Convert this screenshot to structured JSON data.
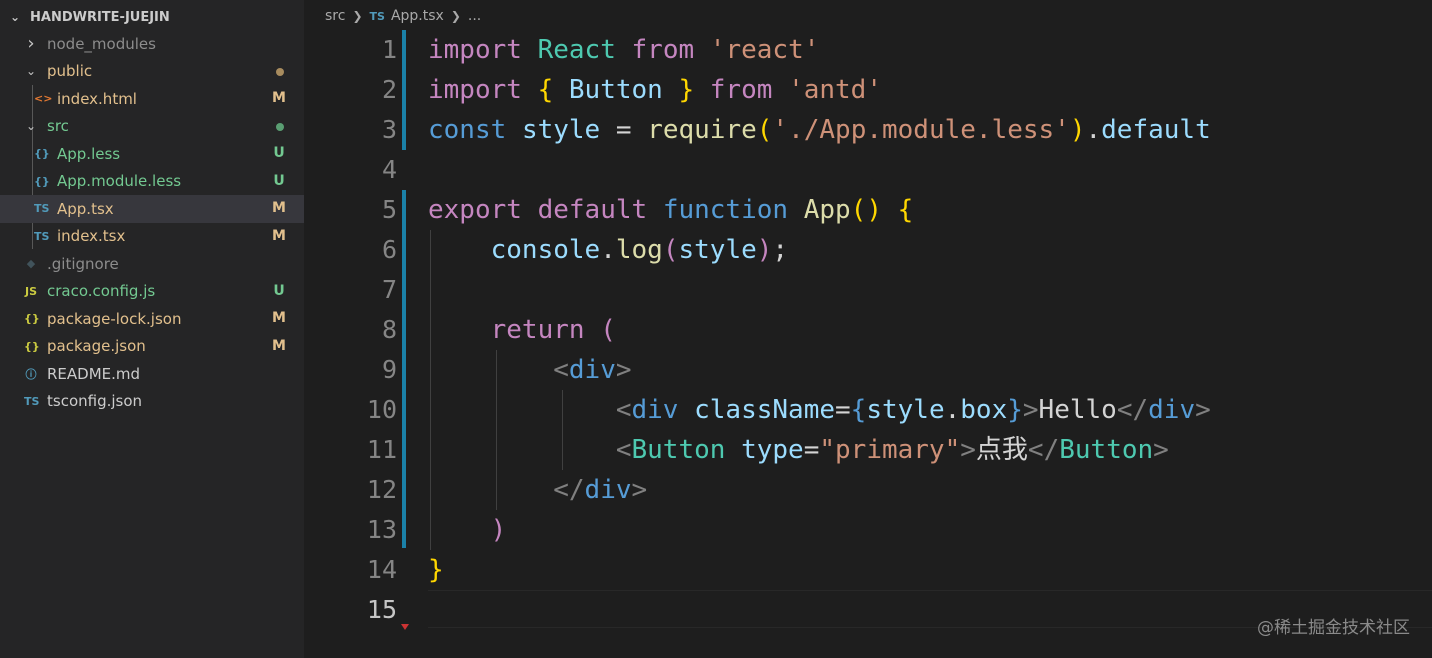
{
  "explorer": {
    "title": "HANDWRITE-JUEJIN",
    "items": [
      {
        "label": "node_modules",
        "kind": "folder",
        "state": "collapsed",
        "depth": 1,
        "color": "#8c8c8c",
        "status": "",
        "status_color": ""
      },
      {
        "label": "public",
        "kind": "folder",
        "state": "expanded",
        "depth": 1,
        "color": "#e2c08d",
        "status": "dot",
        "status_color": "#a88c5e"
      },
      {
        "label": "index.html",
        "kind": "file",
        "icon": "html-icon",
        "glyph": "<>",
        "icon_color": "#e37933",
        "depth": 2,
        "color": "#e2c08d",
        "status": "M",
        "status_color": "#e2c08d"
      },
      {
        "label": "src",
        "kind": "folder",
        "state": "expanded",
        "depth": 1,
        "color": "#73c991",
        "status": "dot",
        "status_color": "#5a9e72"
      },
      {
        "label": "App.less",
        "kind": "file",
        "icon": "less-icon",
        "glyph": "{}",
        "icon_color": "#519aba",
        "depth": 2,
        "color": "#73c991",
        "status": "U",
        "status_color": "#73c991"
      },
      {
        "label": "App.module.less",
        "kind": "file",
        "icon": "less-icon",
        "glyph": "{}",
        "icon_color": "#519aba",
        "depth": 2,
        "color": "#73c991",
        "status": "U",
        "status_color": "#73c991"
      },
      {
        "label": "App.tsx",
        "kind": "file",
        "icon": "typescript-icon",
        "glyph": "TS",
        "icon_color": "#519aba",
        "depth": 2,
        "color": "#e2c08d",
        "status": "M",
        "status_color": "#e2c08d",
        "selected": true
      },
      {
        "label": "index.tsx",
        "kind": "file",
        "icon": "typescript-icon",
        "glyph": "TS",
        "icon_color": "#519aba",
        "depth": 2,
        "color": "#e2c08d",
        "status": "M",
        "status_color": "#e2c08d"
      },
      {
        "label": ".gitignore",
        "kind": "file",
        "icon": "git-icon",
        "glyph": "◆",
        "icon_color": "#41535b",
        "depth": 1,
        "color": "#8c8c8c",
        "status": "",
        "status_color": ""
      },
      {
        "label": "craco.config.js",
        "kind": "file",
        "icon": "javascript-icon",
        "glyph": "JS",
        "icon_color": "#cbcb41",
        "depth": 1,
        "color": "#73c991",
        "status": "U",
        "status_color": "#73c991"
      },
      {
        "label": "package-lock.json",
        "kind": "file",
        "icon": "json-icon",
        "glyph": "{}",
        "icon_color": "#cbcb41",
        "depth": 1,
        "color": "#e2c08d",
        "status": "M",
        "status_color": "#e2c08d"
      },
      {
        "label": "package.json",
        "kind": "file",
        "icon": "json-icon",
        "glyph": "{}",
        "icon_color": "#cbcb41",
        "depth": 1,
        "color": "#e2c08d",
        "status": "M",
        "status_color": "#e2c08d"
      },
      {
        "label": "README.md",
        "kind": "file",
        "icon": "info-icon",
        "glyph": "ⓘ",
        "icon_color": "#519aba",
        "depth": 1,
        "color": "#cccccc",
        "status": "",
        "status_color": ""
      },
      {
        "label": "tsconfig.json",
        "kind": "file",
        "icon": "tsconfig-icon",
        "glyph": "TS",
        "icon_color": "#519aba",
        "depth": 1,
        "color": "#cccccc",
        "status": "",
        "status_color": ""
      }
    ]
  },
  "breadcrumb": {
    "folder": "src",
    "file_icon": "TS",
    "file": "App.tsx",
    "more": "..."
  },
  "editor": {
    "active_line": 15,
    "lines": [
      {
        "n": "1",
        "tokens": [
          [
            "kw",
            "import"
          ],
          [
            "def",
            " "
          ],
          [
            "tagc",
            "React"
          ],
          [
            "def",
            " "
          ],
          [
            "kw",
            "from"
          ],
          [
            "def",
            " "
          ],
          [
            "str",
            "'react'"
          ]
        ]
      },
      {
        "n": "2",
        "tokens": [
          [
            "kw",
            "import"
          ],
          [
            "def",
            " "
          ],
          [
            "gold",
            "{"
          ],
          [
            "def",
            " "
          ],
          [
            "var",
            "Button"
          ],
          [
            "def",
            " "
          ],
          [
            "gold",
            "}"
          ],
          [
            "def",
            " "
          ],
          [
            "kw",
            "from"
          ],
          [
            "def",
            " "
          ],
          [
            "str",
            "'antd'"
          ]
        ]
      },
      {
        "n": "3",
        "tokens": [
          [
            "st",
            "const"
          ],
          [
            "def",
            " "
          ],
          [
            "var",
            "style"
          ],
          [
            "def",
            " = "
          ],
          [
            "fn",
            "require"
          ],
          [
            "gold",
            "("
          ],
          [
            "str",
            "'./App.module.less'"
          ],
          [
            "gold",
            ")"
          ],
          [
            "def",
            "."
          ],
          [
            "var",
            "default"
          ]
        ]
      },
      {
        "n": "4",
        "tokens": []
      },
      {
        "n": "5",
        "tokens": [
          [
            "kw",
            "export"
          ],
          [
            "def",
            " "
          ],
          [
            "kw",
            "default"
          ],
          [
            "def",
            " "
          ],
          [
            "st",
            "function"
          ],
          [
            "def",
            " "
          ],
          [
            "fn",
            "App"
          ],
          [
            "gold",
            "()"
          ],
          [
            "def",
            " "
          ],
          [
            "gold",
            "{"
          ]
        ]
      },
      {
        "n": "6",
        "tokens": [
          [
            "def",
            "    "
          ],
          [
            "var",
            "console"
          ],
          [
            "def",
            "."
          ],
          [
            "fn",
            "log"
          ],
          [
            "kw",
            "("
          ],
          [
            "var",
            "style"
          ],
          [
            "kw",
            ")"
          ],
          [
            "def",
            ";"
          ]
        ]
      },
      {
        "n": "7",
        "tokens": []
      },
      {
        "n": "8",
        "tokens": [
          [
            "def",
            "    "
          ],
          [
            "kw",
            "return"
          ],
          [
            "def",
            " "
          ],
          [
            "kw",
            "("
          ]
        ]
      },
      {
        "n": "9",
        "tokens": [
          [
            "def",
            "        "
          ],
          [
            "br",
            "<"
          ],
          [
            "tag",
            "div"
          ],
          [
            "br",
            ">"
          ]
        ]
      },
      {
        "n": "10",
        "tokens": [
          [
            "def",
            "            "
          ],
          [
            "br",
            "<"
          ],
          [
            "tag",
            "div"
          ],
          [
            "def",
            " "
          ],
          [
            "var",
            "className"
          ],
          [
            "def",
            "="
          ],
          [
            "bk",
            "{"
          ],
          [
            "var",
            "style"
          ],
          [
            "def",
            "."
          ],
          [
            "var",
            "box"
          ],
          [
            "bk",
            "}"
          ],
          [
            "br",
            ">"
          ],
          [
            "def",
            "Hello"
          ],
          [
            "br",
            "</"
          ],
          [
            "tag",
            "div"
          ],
          [
            "br",
            ">"
          ]
        ]
      },
      {
        "n": "11",
        "tokens": [
          [
            "def",
            "            "
          ],
          [
            "br",
            "<"
          ],
          [
            "tagc",
            "Button"
          ],
          [
            "def",
            " "
          ],
          [
            "var",
            "type"
          ],
          [
            "def",
            "="
          ],
          [
            "str",
            "\"primary\""
          ],
          [
            "br",
            ">"
          ],
          [
            "def",
            "点我"
          ],
          [
            "br",
            "</"
          ],
          [
            "tagc",
            "Button"
          ],
          [
            "br",
            ">"
          ]
        ]
      },
      {
        "n": "12",
        "tokens": [
          [
            "def",
            "        "
          ],
          [
            "br",
            "</"
          ],
          [
            "tag",
            "div"
          ],
          [
            "br",
            ">"
          ]
        ]
      },
      {
        "n": "13",
        "tokens": [
          [
            "def",
            "    "
          ],
          [
            "kw",
            ")"
          ]
        ]
      },
      {
        "n": "14",
        "tokens": [
          [
            "gold",
            "}"
          ]
        ]
      },
      {
        "n": "15",
        "tokens": []
      }
    ]
  },
  "watermark": "@稀土掘金技术社区"
}
